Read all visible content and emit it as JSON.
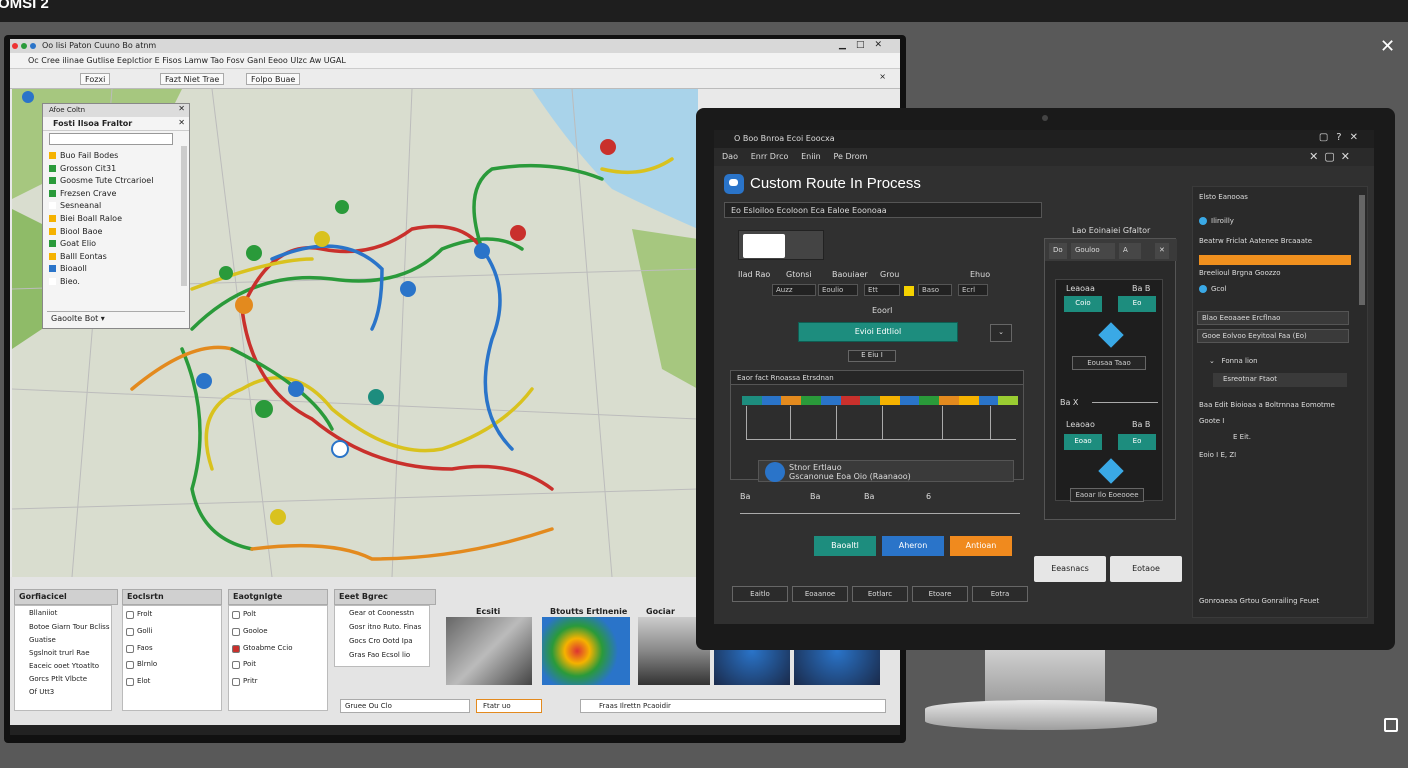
{
  "app": {
    "title": "OMSI 2"
  },
  "left_window": {
    "title": "Oo lisi Paton Cuuno Bo atnm ",
    "menu": "Oc Cree ilinae Gutlise Eeplctior E Fisos Lamw Tao Fosv Ganl Eeoo Ulzc Aw UGAL",
    "toolbar": {
      "btn1": "Fozxi",
      "btn2": "Fazt Niet Trae",
      "btn3": "Folpo Buae",
      "close": "×"
    },
    "side_panel": {
      "header": "Afoe Coltn",
      "title": "Fosti Ilsoa Fraltor",
      "search_placeholder": "",
      "items": [
        {
          "label": "Buo Fail Bodes",
          "color": "#f5b200"
        },
        {
          "label": "Grosson Cit31",
          "color": "#2a9a3a"
        },
        {
          "label": "Goosme Tute Ctrcarioel",
          "color": "#2a9a3a"
        },
        {
          "label": "Frezsen Crave",
          "color": "#2a9a3a"
        },
        {
          "label": "Sesneanal",
          "color": "#ffffff"
        },
        {
          "label": "Biei Boall Raloe",
          "color": "#f5b200"
        },
        {
          "label": "Biool Baoe",
          "color": "#f5b200"
        },
        {
          "label": "Goat Elio",
          "color": "#2a9a3a"
        },
        {
          "label": "Balll Eontas",
          "color": "#f5b200"
        },
        {
          "label": "Bioaoll",
          "color": "#2a74c9"
        },
        {
          "label": "Bieo.",
          "color": "#ffffff"
        }
      ],
      "footer": "Gaoolte Bot"
    },
    "bottom": {
      "tab1": "Gorfiacicel",
      "tab2": "Eoclsrtn",
      "tab3": "Eaotgnlgte",
      "tab4": "Eeet Bgrec",
      "list1": [
        "Bllaniiot",
        "Botoe Giarn Tour Bcliss",
        "Guatise",
        "Sgslnoit trurl Rae",
        "Eaceic ooet Ytoatlto",
        "Gorcs Ptlt Vlbcte",
        "Of Utt3"
      ],
      "list2": [
        "Frolt",
        "Golli",
        "Faos",
        "Blrnlo",
        "Elot"
      ],
      "list3": [
        "Polt",
        "Gooloe",
        "Gtoabme Ccio",
        "Poit",
        "Pritr"
      ],
      "list4": [
        "Gear ot Coonesstn",
        "Gosr itno Ruto. Finas",
        "Gocs Cro Ootd Ipa",
        "Gras  Fao Ecsol lio"
      ],
      "thumb_labels": [
        "Ecsiti",
        "Btoutts Ertlnenie",
        "Gociar"
      ],
      "status1": "Gruee Ou Clo",
      "status2": "Ftatr uo",
      "status3": "Fraas  Ilrettn Pcaoidir"
    }
  },
  "right_window": {
    "title": "O Boo  Bnroa  Ecoi Eoocxa",
    "menu": {
      "item1": "Dao",
      "item2": "Enrr Drco",
      "item3": "Eniin",
      "item4": "Pe Drom"
    },
    "heading": "Custom Route In Process",
    "toolbar": "Eo  Esloiloo   Ecoloon  Eca Ealoe   Eoonoaa",
    "labels": {
      "l1": "Ilad Rao",
      "l2": "Gtonsi",
      "l3": "Baouiaer",
      "l4": "Grou",
      "l5": "Ehuo"
    },
    "values": {
      "v1": "Auzz",
      "v2": "Eoulio",
      "v3": "Ett",
      "v4": "Baso",
      "v5": "Ecrl"
    },
    "small_label": "Eoorl",
    "teal_btn": "Evioi Edtliol",
    "small_box": "E Eiu I",
    "subwin_title": "Eaor fact Rnoassa Etrsdnan",
    "route_label1": "Stnor Ertlauo",
    "route_label2": "Gscanonue Eoa Oio (Raanaoo)",
    "slider_labels": {
      "a": "Ba",
      "b": "Ba",
      "c": "Ba",
      "d": "6"
    },
    "btn_teal": "Baoaltl",
    "btn_blue": "Aheron",
    "btn_orange": "Antioan",
    "light_btn1": "Eeasnacs",
    "light_btn2": "Eotaoe",
    "bottom_btns": [
      "Eaitlo",
      "Eoaanoe",
      "Eotlarc",
      "Etoare",
      "Eotra"
    ],
    "panelB": {
      "top_label": "Lao Eoinaiei Gfaltor",
      "tab1": "Do",
      "tab2": "Gouloo",
      "tab3": "A",
      "label1": "Leaoaa",
      "label2": "Ba B",
      "node1": "Coio",
      "node2": "Eo",
      "out1": "Eousaa Taao",
      "mid": "Ba X",
      "label3": "Leaoao",
      "label4": "Ba B",
      "node3": "Eoao",
      "node4": "Eo",
      "out2": "Eaoar Ilo Eoeooee"
    },
    "panelC": {
      "r1": "Elsto Eanooas",
      "r2": "Iliroilly",
      "r3": "Beatrw Friclat Aatenee Brcaaate",
      "r4": "Breelioul Brgna Goozzo",
      "r5": "Gcol",
      "inp1": "Blao  Eeoaaee  Ercflnao",
      "inp2": "Gooe  Eolvoo  Eeyitoal Faa  (Eo)",
      "r6": "Fonna lion",
      "r7": "Esreotnar Ftaot",
      "r8": "Baa Edit  Bioioaa a Boltrnnaa Eomotme",
      "r9": "Goote  I",
      "r10": "E Eit.",
      "r11": "Eoio  I  E, ZI",
      "footer": "Gonroaeaa Grtou Gonrailing Feuet"
    }
  }
}
